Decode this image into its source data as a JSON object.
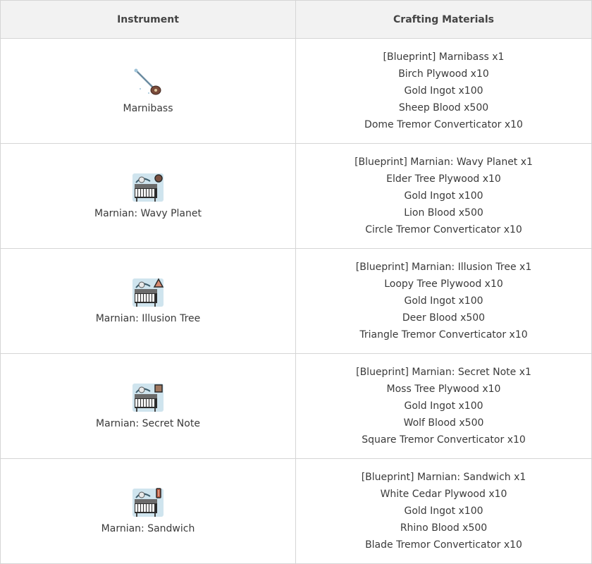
{
  "headers": {
    "instrument": "Instrument",
    "materials": "Crafting Materials"
  },
  "rows": [
    {
      "name": "Marnibass",
      "icon": "bass-instrument-icon",
      "materials": [
        "[Blueprint] Marnibass x1",
        "Birch Plywood x10",
        "Gold Ingot x100",
        "Sheep Blood x500",
        "Dome Tremor Converticator x10"
      ]
    },
    {
      "name": "Marnian: Wavy Planet",
      "icon": "piano-circle-icon",
      "materials": [
        "[Blueprint] Marnian: Wavy Planet x1",
        "Elder Tree Plywood x10",
        "Gold Ingot x100",
        "Lion Blood x500",
        "Circle Tremor Converticator x10"
      ]
    },
    {
      "name": "Marnian: Illusion Tree",
      "icon": "piano-triangle-icon",
      "materials": [
        "[Blueprint] Marnian: Illusion Tree x1",
        "Loopy Tree Plywood x10",
        "Gold Ingot x100",
        "Deer Blood x500",
        "Triangle Tremor Converticator x10"
      ]
    },
    {
      "name": "Marnian: Secret Note",
      "icon": "piano-square-icon",
      "materials": [
        "[Blueprint] Marnian: Secret Note x1",
        "Moss Tree Plywood x10",
        "Gold Ingot x100",
        "Wolf Blood x500",
        "Square Tremor Converticator x10"
      ]
    },
    {
      "name": "Marnian: Sandwich",
      "icon": "piano-blade-icon",
      "materials": [
        "[Blueprint] Marnian: Sandwich x1",
        "White Cedar Plywood x10",
        "Gold Ingot x100",
        "Rhino Blood x500",
        "Blade Tremor Converticator x10"
      ]
    }
  ]
}
